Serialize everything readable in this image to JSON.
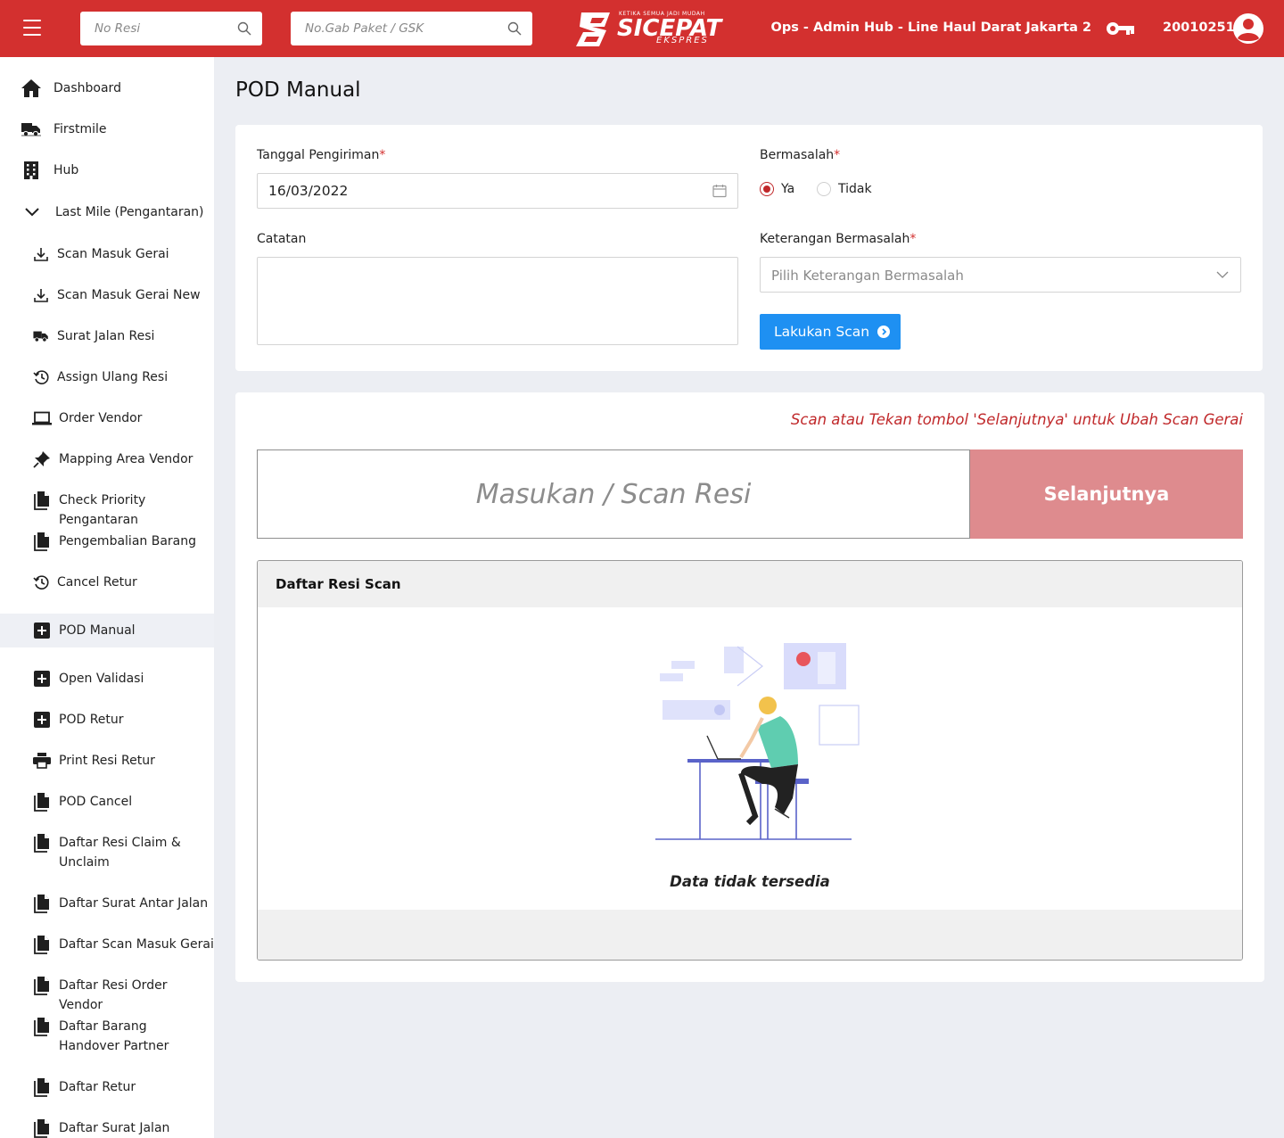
{
  "header": {
    "search_resi_placeholder": "No Resi",
    "search_gabpaket_placeholder": "No.Gab Paket / GSK",
    "brand_tagline": "KETIKA SEMUA JADI MUDAH",
    "brand_name": "SICEPAT",
    "brand_sub": "EKSPRES",
    "user_role": "Ops - Admin Hub - Line Haul Darat Jakarta 2",
    "user_id": "20010251",
    "colors": {
      "primary": "#d3302f",
      "accent_blue": "#1e90f2",
      "next_button": "#de8b8e"
    }
  },
  "sidebar": {
    "items": [
      {
        "label": "Dashboard",
        "icon": "home-icon"
      },
      {
        "label": "Firstmile",
        "icon": "truck-icon"
      },
      {
        "label": "Hub",
        "icon": "building-icon"
      },
      {
        "label": "Last Mile (Pengantaran)",
        "icon": "chevron-down-icon"
      },
      {
        "label": "Scan Masuk Gerai",
        "icon": "download-icon"
      },
      {
        "label": "Scan Masuk Gerai New",
        "icon": "download-icon"
      },
      {
        "label": "Surat Jalan Resi",
        "icon": "truck-icon"
      },
      {
        "label": "Assign Ulang Resi",
        "icon": "history-icon"
      },
      {
        "label": "Order Vendor",
        "icon": "laptop-icon"
      },
      {
        "label": "Mapping Area Vendor",
        "icon": "pin-icon"
      },
      {
        "label": "Check Priority Pengantaran",
        "icon": "document-icon"
      },
      {
        "label": "Pengembalian Barang",
        "icon": "document-icon"
      },
      {
        "label": "Cancel Retur",
        "icon": "history-icon"
      },
      {
        "label": "POD Manual",
        "icon": "plus-box-icon",
        "active": true
      },
      {
        "label": "Open Validasi",
        "icon": "plus-box-icon"
      },
      {
        "label": "POD Retur",
        "icon": "plus-box-icon"
      },
      {
        "label": "Print Resi Retur",
        "icon": "printer-icon"
      },
      {
        "label": "POD Cancel",
        "icon": "document-icon"
      },
      {
        "label": "Daftar Resi Claim & Unclaim",
        "icon": "document-icon"
      },
      {
        "label": "Daftar Surat Antar Jalan",
        "icon": "document-icon"
      },
      {
        "label": "Daftar Scan Masuk Gerai",
        "icon": "document-icon"
      },
      {
        "label": "Daftar Resi Order Vendor",
        "icon": "document-icon"
      },
      {
        "label": "Daftar Barang Handover Partner",
        "icon": "document-icon"
      },
      {
        "label": "Daftar Retur",
        "icon": "document-icon"
      },
      {
        "label": "Daftar Surat Jalan Transit",
        "icon": "document-icon"
      }
    ]
  },
  "page": {
    "title": "POD Manual"
  },
  "form": {
    "tanggal_label": "Tanggal Pengiriman",
    "tanggal_value": "16/03/2022",
    "bermasalah_label": "Bermasalah",
    "bermasalah_options": [
      "Ya",
      "Tidak"
    ],
    "bermasalah_selected": "Ya",
    "catatan_label": "Catatan",
    "catatan_value": "",
    "keterangan_label": "Keterangan Bermasalah",
    "keterangan_placeholder": "Pilih Keterangan Bermasalah",
    "required_mark": "*",
    "scan_button": "Lakukan Scan"
  },
  "scan": {
    "hint": "Scan atau Tekan tombol 'Selanjutnya' untuk Ubah Scan Gerai",
    "input_placeholder": "Masukan / Scan Resi",
    "next_button": "Selanjutnya",
    "list_title": "Daftar Resi Scan",
    "empty_text": "Data tidak tersedia"
  }
}
